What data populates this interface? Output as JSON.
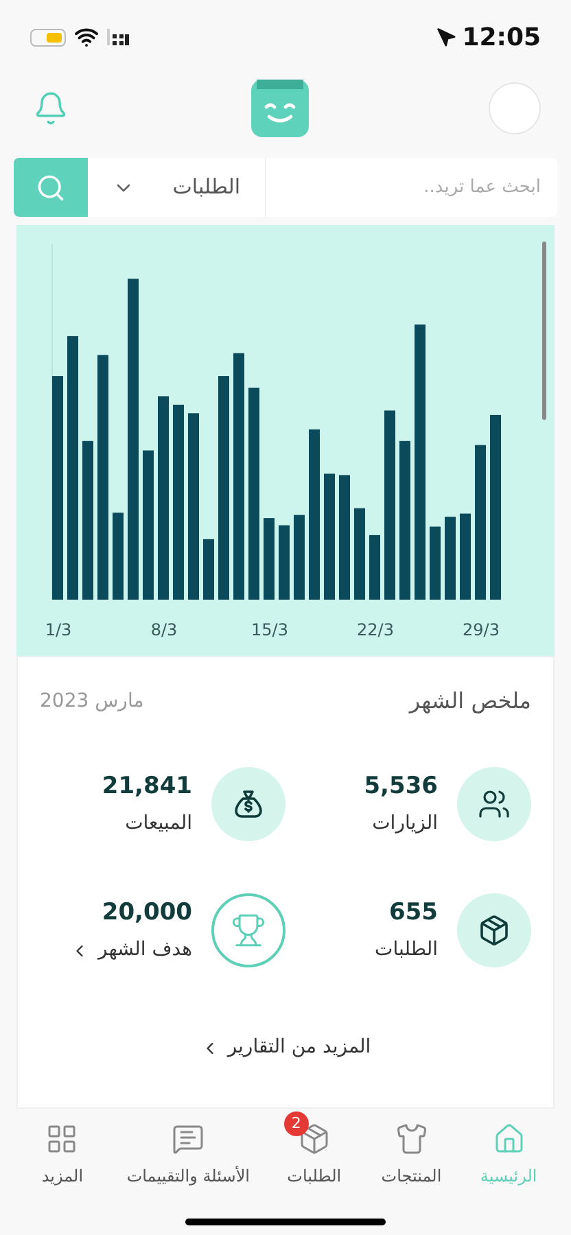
{
  "status_bar": {
    "time": "12:05"
  },
  "search": {
    "placeholder": "ابحث عما تريد..",
    "scope": "الطلبات"
  },
  "chart": {
    "x_labels": [
      "29/3",
      "22/3",
      "15/3",
      "8/3",
      "1/3"
    ]
  },
  "summary": {
    "title": "ملخص الشهر",
    "period": "مارس 2023",
    "stats": [
      {
        "value": "5,536",
        "label": "الزيارات",
        "kind": "filled",
        "has_chevron": false
      },
      {
        "value": "21,841",
        "label": "المبيعات",
        "kind": "filled",
        "has_chevron": false
      },
      {
        "value": "655",
        "label": "الطلبات",
        "kind": "filled",
        "has_chevron": false
      },
      {
        "value": "20,000",
        "label": "هدف الشهر",
        "kind": "outlined",
        "has_chevron": true
      }
    ],
    "more_link": "المزيد من التقارير"
  },
  "tab_bar": [
    {
      "label": "الرئيسية",
      "selected": true
    },
    {
      "label": "المنتجات",
      "selected": false
    },
    {
      "label": "الطلبات",
      "selected": false,
      "badge": "2"
    },
    {
      "label": "الأسئلة والتقييمات",
      "selected": false
    },
    {
      "label": "المزيد",
      "selected": false
    }
  ]
}
